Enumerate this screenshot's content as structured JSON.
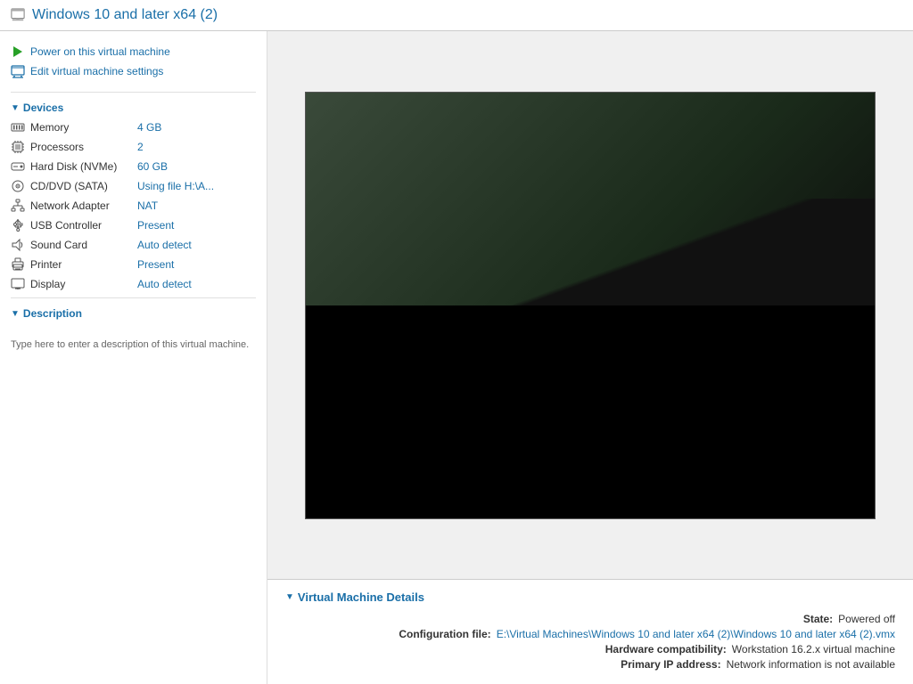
{
  "title": {
    "icon_label": "vm-window-icon",
    "text": "Windows 10 and later x64 (2)"
  },
  "actions": {
    "power_on": {
      "label": "Power on this virtual machine",
      "icon": "play-icon"
    },
    "edit_settings": {
      "label": "Edit virtual machine settings",
      "icon": "settings-icon"
    }
  },
  "devices_section": {
    "header": "Devices",
    "items": [
      {
        "name": "Memory",
        "value": "4 GB",
        "icon": "memory-icon"
      },
      {
        "name": "Processors",
        "value": "2",
        "icon": "processor-icon"
      },
      {
        "name": "Hard Disk (NVMe)",
        "value": "60 GB",
        "icon": "harddisk-icon"
      },
      {
        "name": "CD/DVD (SATA)",
        "value": "Using file H:\\A...",
        "icon": "cdrom-icon"
      },
      {
        "name": "Network Adapter",
        "value": "NAT",
        "icon": "network-icon"
      },
      {
        "name": "USB Controller",
        "value": "Present",
        "icon": "usb-icon"
      },
      {
        "name": "Sound Card",
        "value": "Auto detect",
        "icon": "sound-icon"
      },
      {
        "name": "Printer",
        "value": "Present",
        "icon": "printer-icon"
      },
      {
        "name": "Display",
        "value": "Auto detect",
        "icon": "display-icon"
      }
    ]
  },
  "description_section": {
    "header": "Description",
    "placeholder": "Type here to enter a description of this virtual machine."
  },
  "vm_details": {
    "header": "Virtual Machine Details",
    "rows": [
      {
        "label": "State:",
        "value": "Powered off",
        "blue": false
      },
      {
        "label": "Configuration file:",
        "value": "E:\\Virtual Machines\\Windows 10 and later x64 (2)\\Windows 10 and later x64 (2).vmx",
        "blue": true
      },
      {
        "label": "Hardware compatibility:",
        "value": "Workstation 16.2.x virtual machine",
        "blue": false
      },
      {
        "label": "Primary IP address:",
        "value": "Network information is not available",
        "blue": false
      }
    ]
  }
}
